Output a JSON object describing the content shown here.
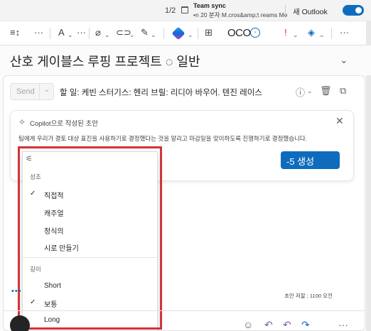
{
  "titlebar": {
    "page_counter": "1/2",
    "meeting_title": "Team sync",
    "meeting_subtitle": "•n 20 분자 M.cros&amp;t reams Me",
    "new_outlook_label": "새 Outlook",
    "toggle_on": true
  },
  "toolbar": {
    "tools": [
      "format-lines-icon",
      "more-icon",
      "text-format-icon",
      "more-icon",
      "attach-icon",
      "link-icon",
      "signature-icon",
      "more-icon",
      "copilot-icon",
      "apps-icon",
      "oco-text",
      "importance-icon",
      "sensitivity-icon",
      "more-icon"
    ],
    "oco_label": "OCO"
  },
  "subject": {
    "text": "산호 게이블스 루핑 프로젝트 ◌ 일반"
  },
  "compose": {
    "send_label": "Send",
    "recipients": "할 일: 케빈 스터기스: 헨리 브릴: 리디아 바우어. 텐진 레이스"
  },
  "copilot": {
    "title": "Copilot으로 작성된 초안",
    "draft_text": "팀에게 우리가 결토 대상 표진을 사용하기로 결정했다는 것을 알리고 마감일을 맞이하도록 진행하기로 결정했습니다.",
    "generate_label": "-5 생성"
  },
  "menu": {
    "tone_header": "성조",
    "tone_items": [
      {
        "label": "직접적",
        "checked": true
      },
      {
        "label": "캐주얼",
        "checked": false
      },
      {
        "label": "정식의",
        "checked": false
      },
      {
        "label": "시로 만들기",
        "checked": false
      }
    ],
    "length_header": "길이",
    "length_items": [
      {
        "label": "Short",
        "checked": false
      },
      {
        "label": "보통",
        "checked": true
      },
      {
        "label": "Long",
        "checked": false
      }
    ]
  },
  "footer": {
    "char_count": "초안 저잘 ; 1100 오전"
  },
  "colors": {
    "accent": "#0f6cbd",
    "highlight": "#d13438"
  }
}
